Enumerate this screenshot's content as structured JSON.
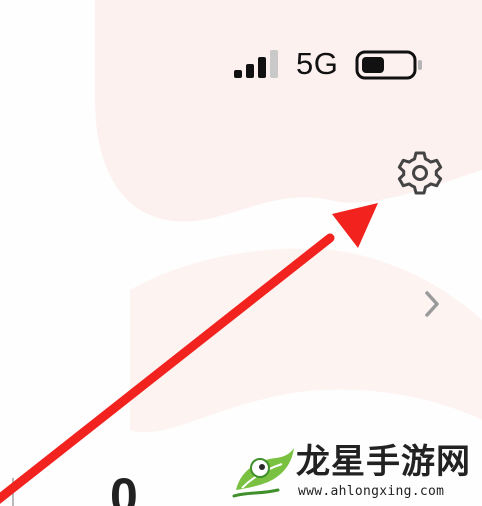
{
  "status_bar": {
    "signal_icon": "cellular-signal-icon",
    "signal_bars_filled": 3,
    "signal_bars_total": 4,
    "network_type": "5G",
    "battery_icon": "battery-icon",
    "battery_level": 0.45
  },
  "settings": {
    "icon": "gear-icon"
  },
  "row": {
    "chevron_icon": "chevron-right-icon"
  },
  "annotation": {
    "arrow_icon": "red-arrow-pointer",
    "color": "#f2231f"
  },
  "partial_content": {
    "value": "0"
  },
  "watermark": {
    "logo_icon": "dragon-leaf-logo",
    "title": "龙星手游网",
    "url": "www.ahlongxing.com",
    "brand_color": "#7ac142"
  },
  "colors": {
    "background": "#fefefe",
    "background_shape": "#fcf1ef",
    "icon_gray": "#444444",
    "chevron_gray": "#9a9a9a",
    "text_dark": "#111111"
  }
}
